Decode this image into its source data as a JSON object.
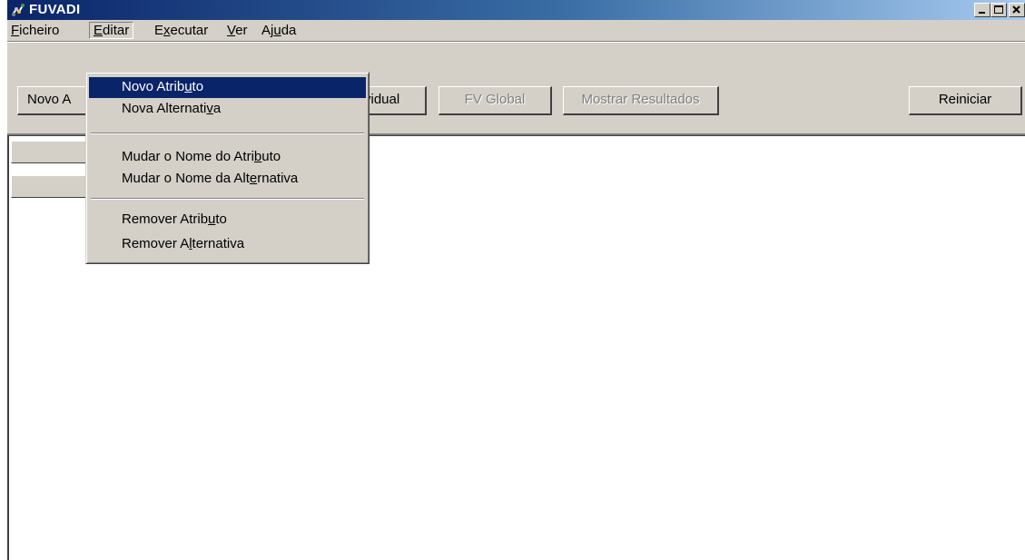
{
  "window": {
    "title": "FUVADI",
    "app_icon": "app-icon",
    "controls": [
      "minimize-icon",
      "maximize-icon",
      "close-icon"
    ]
  },
  "menubar": {
    "items": [
      {
        "pre": "",
        "key": "F",
        "post": "icheiro"
      },
      {
        "pre": "",
        "key": "E",
        "post": "ditar"
      },
      {
        "pre": "E",
        "key": "x",
        "post": "ecutar"
      },
      {
        "pre": "",
        "key": "V",
        "post": "er"
      },
      {
        "pre": "Aj",
        "key": "u",
        "post": "da"
      }
    ],
    "open_menu": "Editar"
  },
  "toolbar": {
    "buttons": [
      {
        "label": "Novo A",
        "enabled": true
      },
      {
        "label": "vidual",
        "enabled": true
      },
      {
        "label": "FV Global",
        "enabled": false
      },
      {
        "label": "Mostrar Resultados",
        "enabled": false
      },
      {
        "label": "Reiniciar",
        "enabled": true
      }
    ]
  },
  "dropdown": {
    "items": [
      {
        "pre": "Novo Atrib",
        "key": "u",
        "post": "to",
        "highlighted": true
      },
      {
        "pre": "Nova Alternati",
        "key": "v",
        "post": "a",
        "highlighted": false
      },
      {
        "pre": "Mudar o Nome do Atri",
        "key": "b",
        "post": "uto",
        "highlighted": false
      },
      {
        "pre": "Mudar o Nome da Alt",
        "key": "e",
        "post": "rnativa",
        "highlighted": false
      },
      {
        "pre": "Remover Atrib",
        "key": "u",
        "post": "to",
        "highlighted": false
      },
      {
        "pre": "Remover A",
        "key": "l",
        "post": "ternativa",
        "highlighted": false
      }
    ]
  },
  "colors": {
    "title_bar_start": "#0a246a",
    "title_bar_end": "#a6caf0",
    "face": "#d4d0c8",
    "highlight": "#0a246a",
    "client": "#ffffff"
  }
}
